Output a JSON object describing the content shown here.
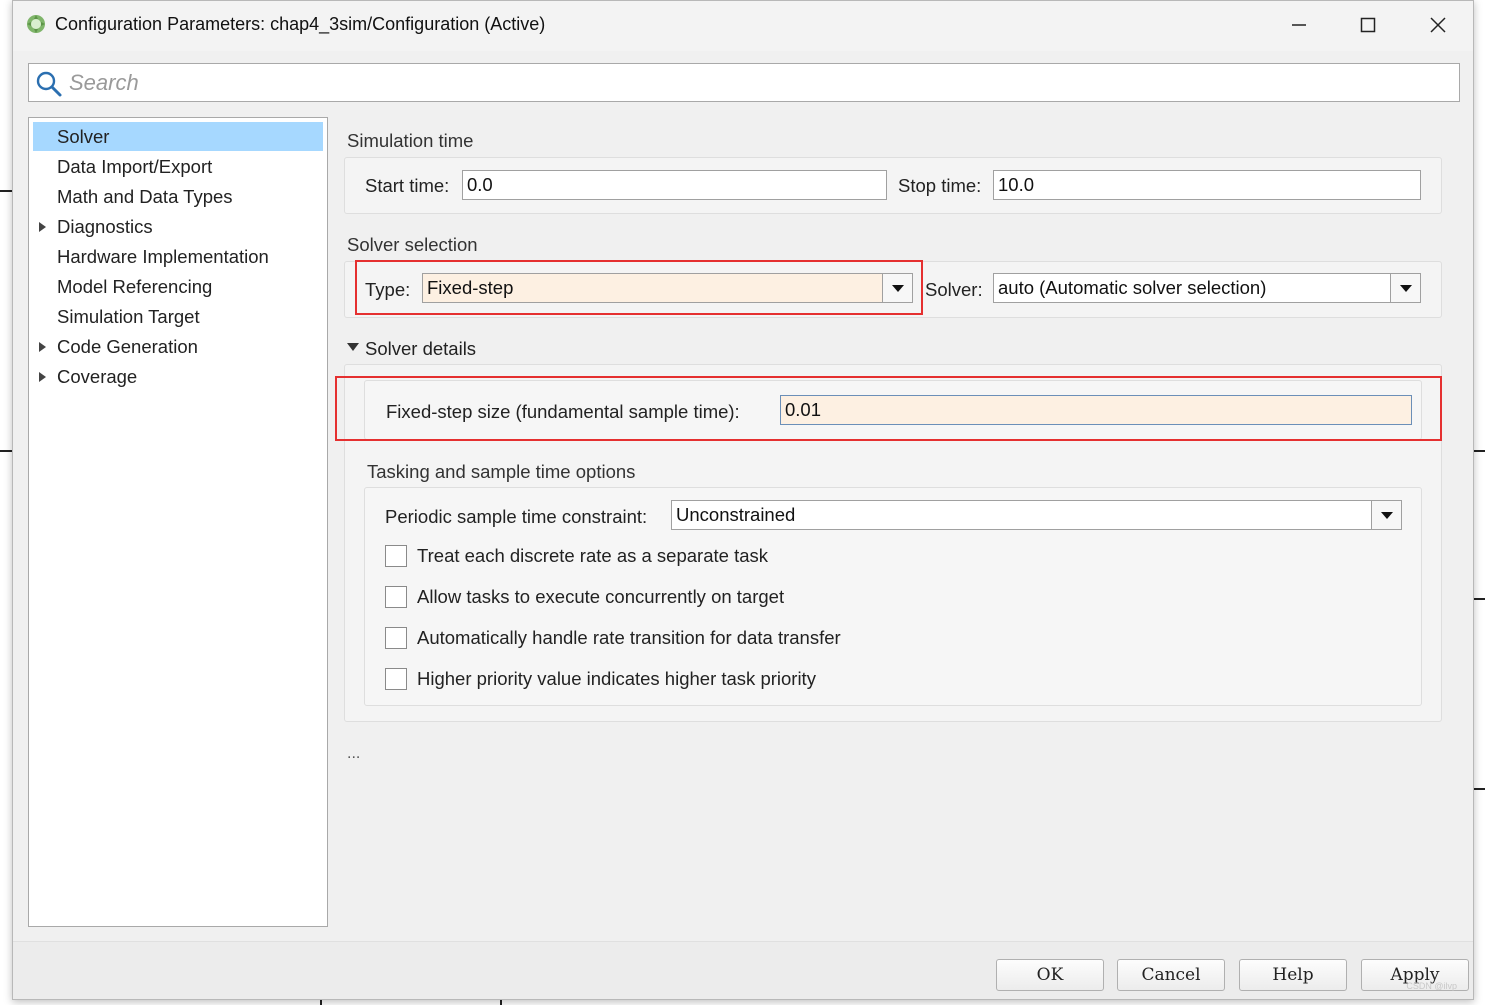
{
  "window": {
    "title": "Configuration Parameters: chap4_3sim/Configuration (Active)"
  },
  "search": {
    "placeholder": "Search"
  },
  "nav": {
    "items": [
      {
        "label": "Solver",
        "selected": true,
        "expandable": false
      },
      {
        "label": "Data Import/Export",
        "selected": false,
        "expandable": false
      },
      {
        "label": "Math and Data Types",
        "selected": false,
        "expandable": false
      },
      {
        "label": "Diagnostics",
        "selected": false,
        "expandable": true
      },
      {
        "label": "Hardware Implementation",
        "selected": false,
        "expandable": false
      },
      {
        "label": "Model Referencing",
        "selected": false,
        "expandable": false
      },
      {
        "label": "Simulation Target",
        "selected": false,
        "expandable": false
      },
      {
        "label": "Code Generation",
        "selected": false,
        "expandable": true
      },
      {
        "label": "Coverage",
        "selected": false,
        "expandable": true
      }
    ]
  },
  "simulation_time": {
    "title": "Simulation time",
    "start_label": "Start time:",
    "start_value": "0.0",
    "stop_label": "Stop time:",
    "stop_value": "10.0"
  },
  "solver_selection": {
    "title": "Solver selection",
    "type_label": "Type:",
    "type_value": "Fixed-step",
    "solver_label": "Solver:",
    "solver_value": "auto (Automatic solver selection)"
  },
  "solver_details": {
    "title": "Solver details",
    "step_size_label": "Fixed-step size (fundamental sample time):",
    "step_size_value": "0.01"
  },
  "tasking": {
    "title": "Tasking and sample time options",
    "constraint_label": "Periodic sample time constraint:",
    "constraint_value": "Unconstrained",
    "checkboxes": [
      {
        "label": "Treat each discrete rate as a separate task",
        "checked": false
      },
      {
        "label": "Allow tasks to execute concurrently on target",
        "checked": false
      },
      {
        "label": "Automatically handle rate transition for data transfer",
        "checked": false
      },
      {
        "label": "Higher priority value indicates higher task priority",
        "checked": false
      }
    ]
  },
  "ellipsis": "...",
  "footer": {
    "ok": "OK",
    "cancel": "Cancel",
    "help": "Help",
    "apply": "Apply"
  },
  "watermark": "CSDN @ilvp",
  "colors": {
    "selected_nav": "#a6d8ff",
    "highlight_field": "#fdf0e2",
    "annotation_red": "#e53030"
  }
}
